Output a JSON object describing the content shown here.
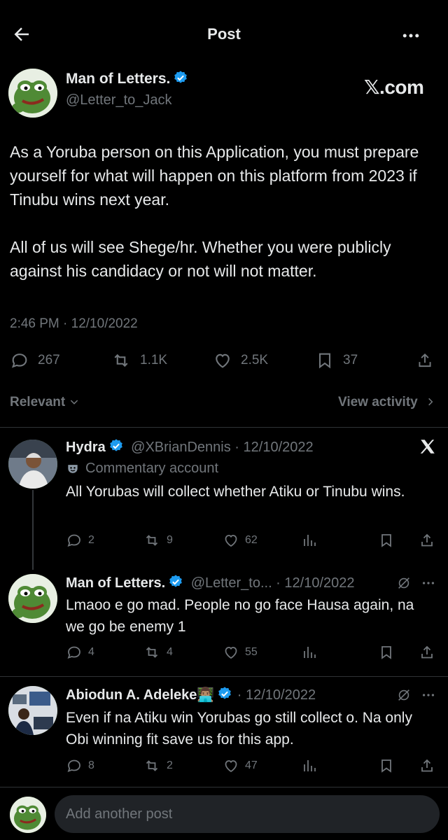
{
  "header": {
    "title": "Post"
  },
  "post": {
    "author_name": "Man of Letters.",
    "author_handle": "@Letter_to_Jack",
    "watermark": "𝕏.com",
    "text": "As a Yoruba person on this Application, you must prepare yourself for what will happen on this platform from 2023 if Tinubu wins next year.\n\nAll of us will see Shege/hr. Whether you were publicly against his candidacy or not will not matter.",
    "timestamp": "2:46 PM · 12/10/2022",
    "stats": {
      "replies": "267",
      "reposts": "1.1K",
      "likes": "2.5K",
      "bookmarks": "37"
    }
  },
  "sort": {
    "label": "Relevant",
    "view_activity": "View activity"
  },
  "replies": [
    {
      "name": "Hydra",
      "handle_date": "@XBrianDennis · 12/10/2022",
      "label": "Commentary account",
      "text": "All Yorubas will collect whether Atiku or Tinubu wins.",
      "replies": "2",
      "reposts": "9",
      "likes": "62"
    },
    {
      "name": "Man of Letters.",
      "handle_date": "@Letter_to... · 12/10/2022",
      "text": "Lmaoo e go mad. People no go face Hausa again, na we go be enemy 1",
      "replies": "4",
      "reposts": "4",
      "likes": "55"
    },
    {
      "name": "Abiodun A. Adeleke👨🏽‍💻",
      "handle_date": "· 12/10/2022",
      "text": "Even if na Atiku win Yorubas go still collect o. Na only Obi winning fit save us for this app.",
      "replies": "8",
      "reposts": "2",
      "likes": "47"
    }
  ],
  "composer": {
    "placeholder": "Add another post"
  },
  "colors": {
    "background": "#000000",
    "text": "#e7e9ea",
    "muted": "#71767b",
    "verified": "#1d9bf0",
    "divider": "#2f3336"
  }
}
